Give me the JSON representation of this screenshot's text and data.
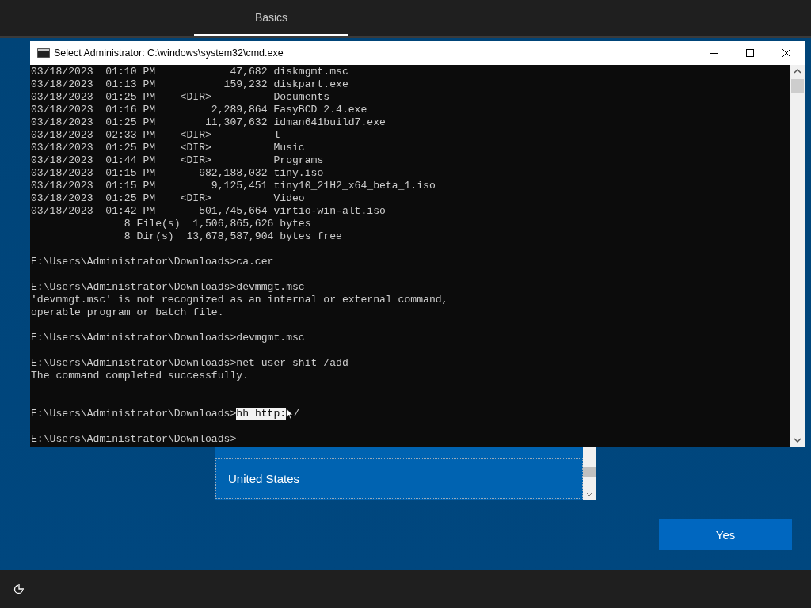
{
  "header": {
    "tabs": [
      {
        "label": "Basics",
        "selected": true
      }
    ]
  },
  "console_window": {
    "title": "Select Administrator: C:\\windows\\system32\\cmd.exe",
    "lines": [
      {
        "kind": "text",
        "text": "03/18/2023  01:10 PM            47,682 diskmgmt.msc"
      },
      {
        "kind": "text",
        "text": "03/18/2023  01:13 PM           159,232 diskpart.exe"
      },
      {
        "kind": "text",
        "text": "03/18/2023  01:25 PM    <DIR>          Documents"
      },
      {
        "kind": "text",
        "text": "03/18/2023  01:16 PM         2,289,864 EasyBCD 2.4.exe"
      },
      {
        "kind": "text",
        "text": "03/18/2023  01:25 PM        11,307,632 idman641build7.exe"
      },
      {
        "kind": "text",
        "text": "03/18/2023  02:33 PM    <DIR>          l"
      },
      {
        "kind": "text",
        "text": "03/18/2023  01:25 PM    <DIR>          Music"
      },
      {
        "kind": "text",
        "text": "03/18/2023  01:44 PM    <DIR>          Programs"
      },
      {
        "kind": "text",
        "text": "03/18/2023  01:15 PM       982,188,032 tiny.iso"
      },
      {
        "kind": "text",
        "text": "03/18/2023  01:15 PM         9,125,451 tiny10_21H2_x64_beta_1.iso"
      },
      {
        "kind": "text",
        "text": "03/18/2023  01:25 PM    <DIR>          Video"
      },
      {
        "kind": "text",
        "text": "03/18/2023  01:42 PM       501,745,664 virtio-win-alt.iso"
      },
      {
        "kind": "text",
        "text": "               8 File(s)  1,506,865,626 bytes"
      },
      {
        "kind": "text",
        "text": "               8 Dir(s)  13,678,587,904 bytes free"
      },
      {
        "kind": "blank"
      },
      {
        "kind": "text",
        "text": "E:\\Users\\Administrator\\Downloads>ca.cer"
      },
      {
        "kind": "blank"
      },
      {
        "kind": "text",
        "text": "E:\\Users\\Administrator\\Downloads>devmmgt.msc"
      },
      {
        "kind": "text",
        "text": "'devmmgt.msc' is not recognized as an internal or external command,"
      },
      {
        "kind": "text",
        "text": "operable program or batch file."
      },
      {
        "kind": "blank"
      },
      {
        "kind": "text",
        "text": "E:\\Users\\Administrator\\Downloads>devmgmt.msc"
      },
      {
        "kind": "blank"
      },
      {
        "kind": "text",
        "text": "E:\\Users\\Administrator\\Downloads>net user shit /add"
      },
      {
        "kind": "text",
        "text": "The command completed successfully."
      },
      {
        "kind": "blank"
      },
      {
        "kind": "blank"
      },
      {
        "kind": "parts",
        "parts": [
          {
            "text": "E:\\Users\\Administrator\\Downloads>",
            "selected": false
          },
          {
            "text": "hh http:",
            "selected": true
          },
          {
            "text": "/",
            "selected": false
          }
        ]
      },
      {
        "kind": "blank"
      },
      {
        "kind": "text",
        "text": "E:\\Users\\Administrator\\Downloads>"
      }
    ]
  },
  "region_list": {
    "items": [
      {
        "label": "United States",
        "selected": true
      }
    ]
  },
  "buttons": [
    {
      "label": "Yes"
    }
  ]
}
